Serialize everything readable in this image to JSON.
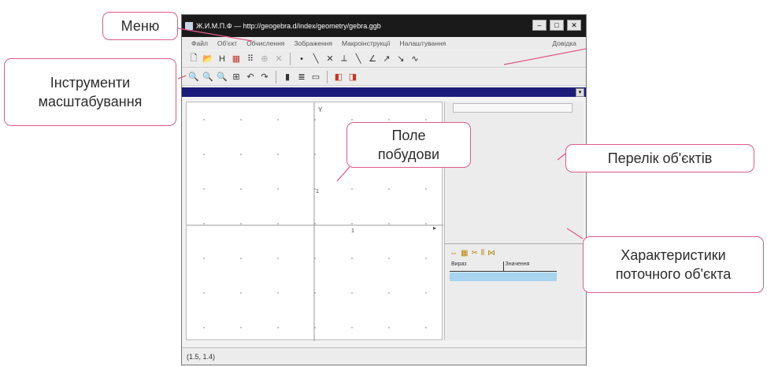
{
  "window": {
    "title": "Ж.И.М.П.Ф — http://geogebra.d/index/geometry/gebra.ggb",
    "controls": [
      "–",
      "□",
      "✕"
    ]
  },
  "menu": {
    "items": [
      "Файл",
      "Об'єкт",
      "Обчислення",
      "Зображення",
      "Макроінструкції",
      "Налаштування"
    ],
    "last": "Довідка"
  },
  "toolbar1": {
    "icons": [
      "new-file-icon",
      "open-file-icon",
      "save-icon",
      "export-icon",
      "grid-icon",
      "pan-icon",
      "delete-icon",
      "point-tool-icon",
      "line-tool-icon",
      "cross-tool-icon",
      "perpendicular-tool-icon",
      "segment-tool-icon",
      "angle-tool-icon",
      "vector-tool-icon",
      "ray-tool-icon",
      "curve-tool-icon"
    ]
  },
  "toolbar2": {
    "icons": [
      "zoom-in-icon",
      "zoom-out-icon",
      "zoom-fit-icon",
      "zoom-window-icon",
      "undo-icon",
      "redo-icon",
      "layer-icon",
      "calc-icon",
      "table-icon",
      "macro-icon",
      "macro-run-icon"
    ]
  },
  "canvas": {
    "axis_y_label": "Y",
    "origin_label": "1",
    "x_tick_label": "1"
  },
  "properties": {
    "col_expression": "Вираз",
    "col_value": "Значення"
  },
  "status": {
    "coords": "(1.5, 1.4)"
  },
  "callouts": {
    "menu": "Меню",
    "zoom_tools": [
      "Інструменти",
      "масштабування"
    ],
    "canvas": [
      "Поле",
      "побудови"
    ],
    "object_list": "Перелік об'єктів",
    "object_props": [
      "Характеристики",
      "поточного об'єкта"
    ]
  },
  "colors": {
    "callout_border": "#e05a8a",
    "title_bar": "#1a1a1a",
    "blue_bar": "#1c1c7a",
    "selected_row": "#a8d4f0"
  }
}
